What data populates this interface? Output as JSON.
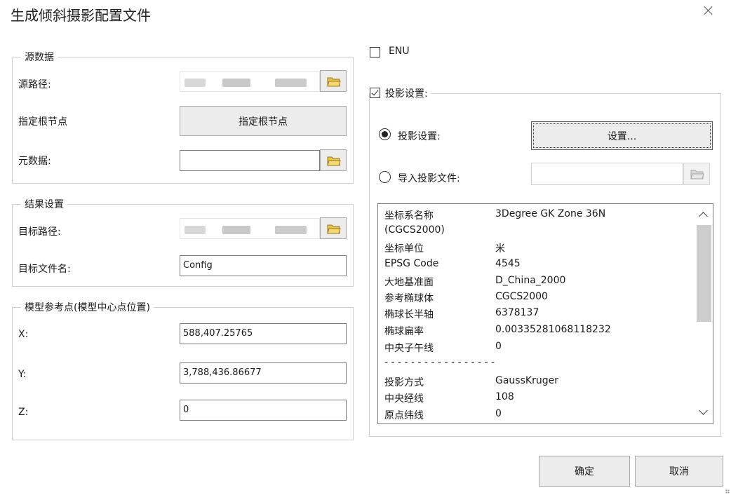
{
  "dialog": {
    "title": "生成倾斜摄影配置文件"
  },
  "source_group": {
    "legend": "源数据",
    "path_label": "源路径:",
    "root_label": "指定根节点",
    "root_button": "指定根节点",
    "meta_label": "元数据:",
    "meta_value": ""
  },
  "result_group": {
    "legend": "结果设置",
    "target_path_label": "目标路径:",
    "target_file_label": "目标文件名:",
    "target_file_value": "Config"
  },
  "ref_group": {
    "legend": "模型参考点(模型中心点位置)",
    "x_label": "X:",
    "x_value": "588,407.25765",
    "y_label": "Y:",
    "y_value": "3,788,436.86677",
    "z_label": "Z:",
    "z_value": "0"
  },
  "enu": {
    "label": "ENU",
    "checked": false
  },
  "projection": {
    "legend": "投影设置:",
    "checked": true,
    "set_radio_label": "投影设置:",
    "set_button": "设置...",
    "import_radio_label": "导入投影文件:",
    "import_value": "",
    "selected": "set"
  },
  "info_rows": [
    {
      "key": "坐标系名称",
      "value": "3Degree GK Zone 36N"
    },
    {
      "key": "(CGCS2000)",
      "value": ""
    },
    {
      "key": "坐标单位",
      "value": "米"
    },
    {
      "key": "EPSG Code",
      "value": "4545"
    },
    {
      "key": "大地基准面",
      "value": "D_China_2000"
    },
    {
      "key": "参考椭球体",
      "value": "CGCS2000"
    },
    {
      "key": "椭球长半轴",
      "value": "6378137"
    },
    {
      "key": "椭球扁率",
      "value": "0.00335281068118232"
    },
    {
      "key": "中央子午线",
      "value": "0"
    },
    {
      "key": "- - - - - - - - - - - - - - - - -",
      "value": ""
    },
    {
      "key": "投影方式",
      "value": "GaussKruger"
    },
    {
      "key": "中央经线",
      "value": "108"
    },
    {
      "key": "原点纬线",
      "value": "0"
    }
  ],
  "footer": {
    "ok": "确定",
    "cancel": "取消"
  },
  "icons": {
    "folder": "folder-open-icon",
    "close": "close-icon"
  }
}
